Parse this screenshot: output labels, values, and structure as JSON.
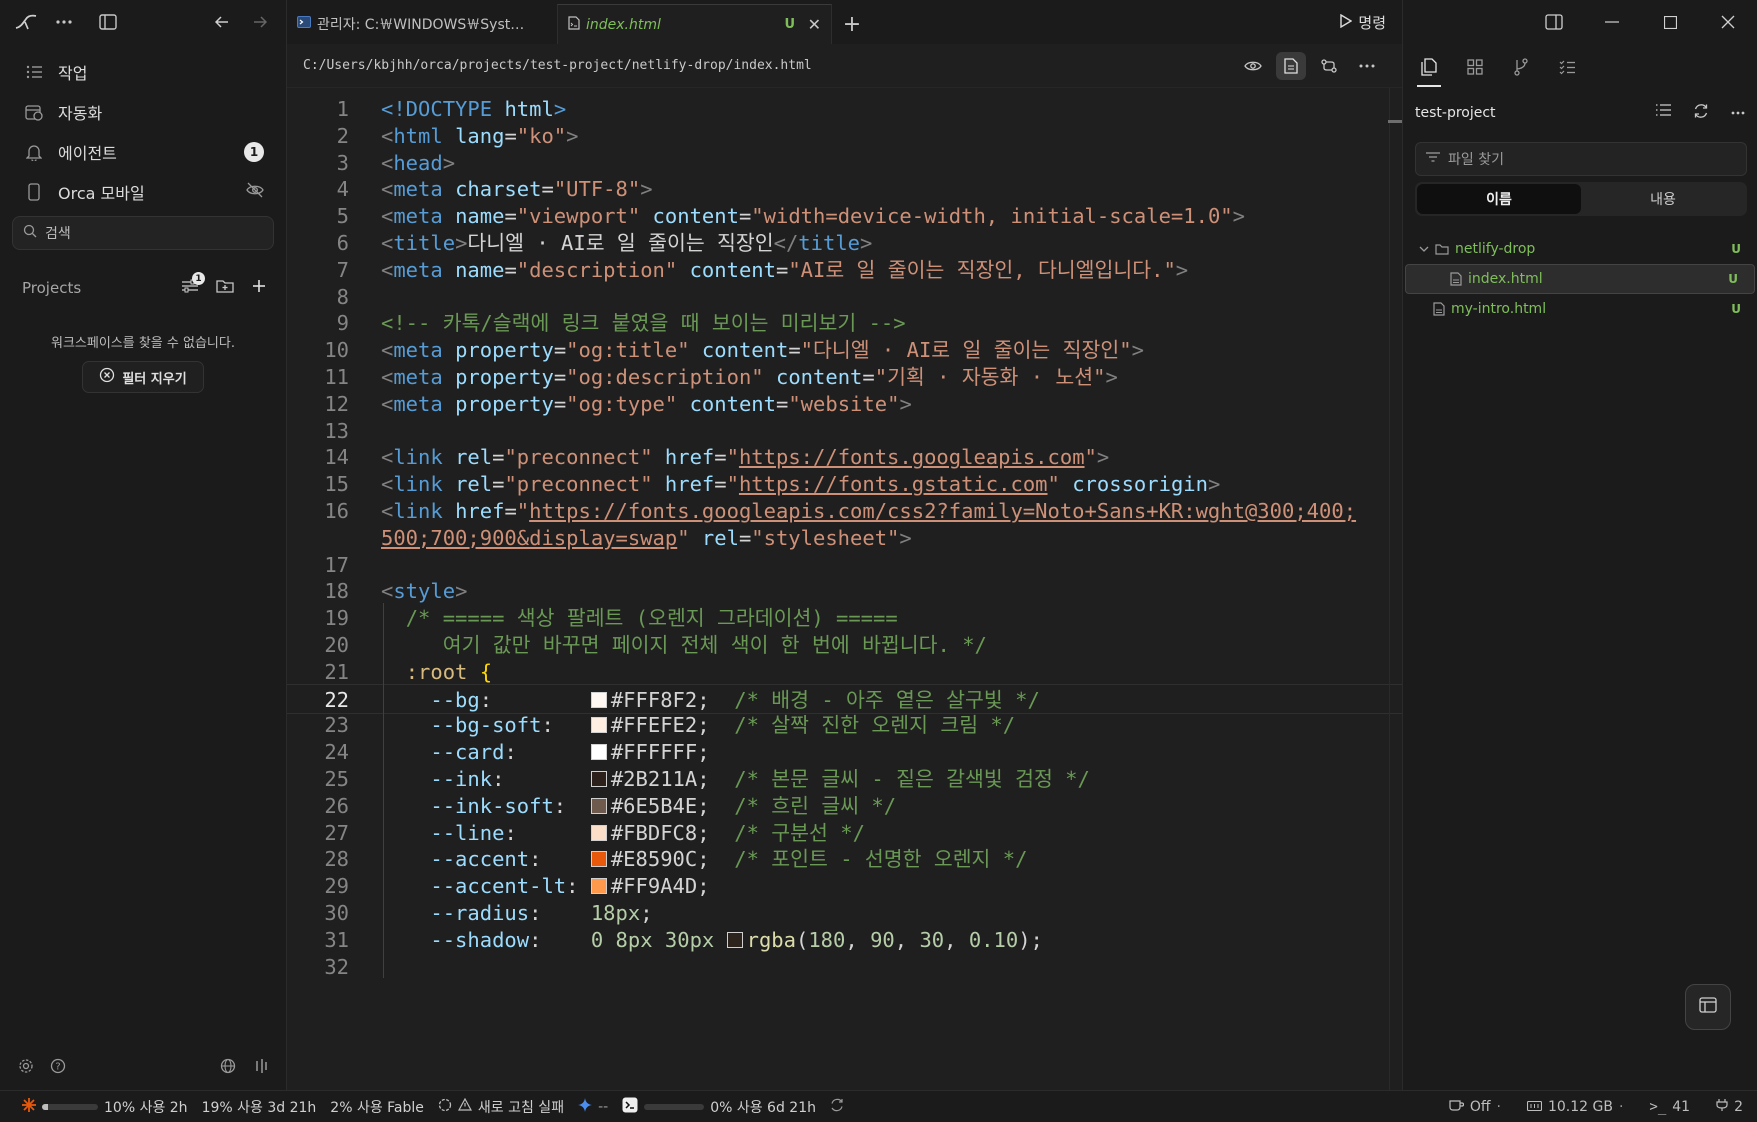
{
  "sidebar": {
    "nav": [
      {
        "label": "작업",
        "icon": "list-icon"
      },
      {
        "label": "자동화",
        "icon": "calendar-clock-icon"
      },
      {
        "label": "에이전트",
        "icon": "bell-icon",
        "badge": "1"
      },
      {
        "label": "Orca 모바일",
        "icon": "phone-icon"
      }
    ],
    "search_placeholder": "검색",
    "projects_label": "Projects",
    "projects_filter_badge": "1",
    "empty_text": "워크스페이스를 찾을 수 없습니다.",
    "clear_filter_label": "필터 지우기"
  },
  "tabs": [
    {
      "label": "관리자: C:￦WINDOWS￦Syst…",
      "icon": "terminal-icon"
    },
    {
      "label": "index.html",
      "status": "U",
      "active": true
    }
  ],
  "run_command_label": "명령",
  "breadcrumb": "C:/Users/kbjhh/orca/projects/test-project/netlify-drop/index.html",
  "editor": {
    "current_line": 22,
    "lines": [
      {
        "n": "1",
        "html": "<span class='t'>&lt;!DOCTYPE</span> <span class='a'>html</span><span class='t'>&gt;</span>"
      },
      {
        "n": "2",
        "html": "<span class='p'>&lt;</span><span class='t'>html</span> <span class='a'>lang</span>=<span class='s'>\"ko\"</span><span class='p'>&gt;</span>"
      },
      {
        "n": "3",
        "html": "<span class='p'>&lt;</span><span class='t'>head</span><span class='p'>&gt;</span>"
      },
      {
        "n": "4",
        "html": "<span class='p'>&lt;</span><span class='t'>meta</span> <span class='a'>charset</span>=<span class='s'>\"UTF-8\"</span><span class='p'>&gt;</span>"
      },
      {
        "n": "5",
        "html": "<span class='p'>&lt;</span><span class='t'>meta</span> <span class='a'>name</span>=<span class='s'>\"viewport\"</span> <span class='a'>content</span>=<span class='s'>\"width=device-width, initial-scale=1.0\"</span><span class='p'>&gt;</span>"
      },
      {
        "n": "6",
        "html": "<span class='p'>&lt;</span><span class='t'>title</span><span class='p'>&gt;</span><span class='w'>다니엘 · AI로 일 줄이는 직장인</span><span class='p'>&lt;/</span><span class='t'>title</span><span class='p'>&gt;</span>"
      },
      {
        "n": "7",
        "html": "<span class='p'>&lt;</span><span class='t'>meta</span> <span class='a'>name</span>=<span class='s'>\"description\"</span> <span class='a'>content</span>=<span class='s'>\"AI로 일 줄이는 직장인, 다니엘입니다.\"</span><span class='p'>&gt;</span>"
      },
      {
        "n": "8",
        "html": ""
      },
      {
        "n": "9",
        "html": "<span class='c'>&lt;!-- 카톡/슬랙에 링크 붙였을 때 보이는 미리보기 --&gt;</span>"
      },
      {
        "n": "10",
        "html": "<span class='p'>&lt;</span><span class='t'>meta</span> <span class='a'>property</span>=<span class='s'>\"og:title\"</span> <span class='a'>content</span>=<span class='s'>\"다니엘 · AI로 일 줄이는 직장인\"</span><span class='p'>&gt;</span>"
      },
      {
        "n": "11",
        "html": "<span class='p'>&lt;</span><span class='t'>meta</span> <span class='a'>property</span>=<span class='s'>\"og:description\"</span> <span class='a'>content</span>=<span class='s'>\"기획 · 자동화 · 노션\"</span><span class='p'>&gt;</span>"
      },
      {
        "n": "12",
        "html": "<span class='p'>&lt;</span><span class='t'>meta</span> <span class='a'>property</span>=<span class='s'>\"og:type\"</span> <span class='a'>content</span>=<span class='s'>\"website\"</span><span class='p'>&gt;</span>"
      },
      {
        "n": "13",
        "html": ""
      },
      {
        "n": "14",
        "html": "<span class='p'>&lt;</span><span class='t'>link</span> <span class='a'>rel</span>=<span class='s'>\"preconnect\"</span> <span class='a'>href</span>=<span class='s'>\"</span><span class='u2'>https://fonts.googleapis.com</span><span class='s'>\"</span><span class='p'>&gt;</span>"
      },
      {
        "n": "15",
        "html": "<span class='p'>&lt;</span><span class='t'>link</span> <span class='a'>rel</span>=<span class='s'>\"preconnect\"</span> <span class='a'>href</span>=<span class='s'>\"</span><span class='u2'>https://fonts.gstatic.com</span><span class='s'>\"</span> <span class='a'>crossorigin</span><span class='p'>&gt;</span>"
      },
      {
        "n": "16",
        "html": "<span class='p'>&lt;</span><span class='t'>link</span> <span class='a'>href</span>=<span class='s'>\"</span><span class='u2'>https://fonts.googleapis.com/css2?family=Noto+Sans+KR:wght@300;400;</span>"
      },
      {
        "n": "",
        "html": "<span class='u2'>500;700;900&amp;display=swap</span><span class='s'>\"</span> <span class='a'>rel</span>=<span class='s'>\"stylesheet\"</span><span class='p'>&gt;</span>"
      },
      {
        "n": "17",
        "html": ""
      },
      {
        "n": "18",
        "html": "<span class='p'>&lt;</span><span class='t'>style</span><span class='p'>&gt;</span>"
      },
      {
        "n": "19",
        "html": "  <span class='c'>/* ===== 색상 팔레트 (오렌지 그라데이션) =====</span>"
      },
      {
        "n": "20",
        "html": "     <span class='c'>여기 값만 바꾸면 페이지 전체 색이 한 번에 바뀝니다. */</span>"
      },
      {
        "n": "21",
        "html": "  <span class='sel'>:root</span> <span class='y'>{</span>"
      },
      {
        "n": "22",
        "html": "    <span class='a'>--bg</span>:        <i class='sw' style='background:#FFF8F2'></i><span class='w'>#FFF8F2</span>;  <span class='c'>/* 배경 - 아주 옅은 살구빛 */</span>"
      },
      {
        "n": "23",
        "html": "    <span class='a'>--bg-soft</span>:   <i class='sw' style='background:#FFEFE2'></i><span class='w'>#FFEFE2</span>;  <span class='c'>/* 살짝 진한 오렌지 크림 */</span>"
      },
      {
        "n": "24",
        "html": "    <span class='a'>--card</span>:      <i class='sw' style='background:#FFFFFF'></i><span class='w'>#FFFFFF</span>;"
      },
      {
        "n": "25",
        "html": "    <span class='a'>--ink</span>:       <i class='sw' style='background:#2B211A'></i><span class='w'>#2B211A</span>;  <span class='c'>/* 본문 글씨 - 짙은 갈색빛 검정 */</span>"
      },
      {
        "n": "26",
        "html": "    <span class='a'>--ink-soft</span>:  <i class='sw' style='background:#6E5B4E'></i><span class='w'>#6E5B4E</span>;  <span class='c'>/* 흐린 글씨 */</span>"
      },
      {
        "n": "27",
        "html": "    <span class='a'>--line</span>:      <i class='sw' style='background:#FBDFC8'></i><span class='w'>#FBDFC8</span>;  <span class='c'>/* 구분선 */</span>"
      },
      {
        "n": "28",
        "html": "    <span class='a'>--accent</span>:    <i class='sw' style='background:#E8590C'></i><span class='w'>#E8590C</span>;  <span class='c'>/* 포인트 - 선명한 오렌지 */</span>"
      },
      {
        "n": "29",
        "html": "    <span class='a'>--accent-lt</span>: <i class='sw' style='background:#FF9A4D'></i><span class='w'>#FF9A4D</span>;"
      },
      {
        "n": "30",
        "html": "    <span class='a'>--radius</span>:    <span class='n'>18px</span>;"
      },
      {
        "n": "31",
        "html": "    <span class='a'>--shadow</span>:    <span class='n'>0</span> <span class='n'>8px</span> <span class='n'>30px</span> <i class='sw' style='background:rgba(180,90,30,0.10)'></i><span class='f'>rgba</span>(<span class='n'>180</span>, <span class='n'>90</span>, <span class='n'>30</span>, <span class='n'>0.10</span>);"
      },
      {
        "n": "32",
        "html": ""
      }
    ]
  },
  "right_panel": {
    "project_name": "test-project",
    "find_placeholder": "파일 찾기",
    "segments": [
      "이름",
      "내용"
    ],
    "tree": [
      {
        "label": "netlify-drop",
        "type": "folder",
        "status": "U"
      },
      {
        "label": "index.html",
        "type": "file",
        "status": "U",
        "selected": true
      },
      {
        "label": "my-intro.html",
        "type": "file",
        "status": "U"
      }
    ]
  },
  "statusbar": {
    "usage": [
      {
        "text": "10% 사용 2h",
        "pct": 0.1
      },
      {
        "text": "19% 사용 3d 21h",
        "pct": 0.19
      },
      {
        "text": "2% 사용 Fable",
        "pct": 0.02
      }
    ],
    "refresh_failed": "새로 고침 실패",
    "dash": "--",
    "codex_usage": "0% 사용 6d 21h",
    "codex_pct": 0.0,
    "power_label": "Off",
    "memory": "10.12 GB",
    "terminals": "41",
    "ports": "2"
  },
  "colors": {
    "accent_green": "#7fbf5a",
    "status_orange": "#e8590c"
  }
}
